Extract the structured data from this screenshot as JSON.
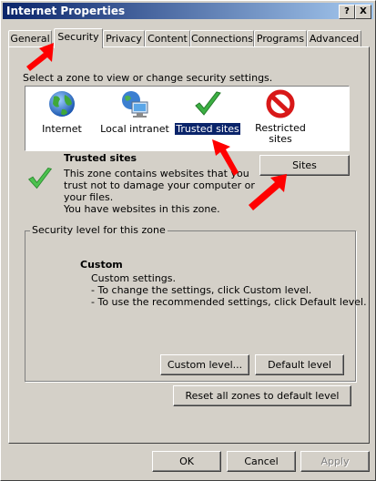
{
  "window": {
    "title": "Internet Properties",
    "help_btn": "?",
    "close_btn": "X"
  },
  "tabs": [
    {
      "label": "General"
    },
    {
      "label": "Security"
    },
    {
      "label": "Privacy"
    },
    {
      "label": "Content"
    },
    {
      "label": "Connections"
    },
    {
      "label": "Programs"
    },
    {
      "label": "Advanced"
    }
  ],
  "security": {
    "instruction": "Select a zone to view or change security settings.",
    "zones": [
      {
        "label": "Internet",
        "icon": "globe-icon"
      },
      {
        "label": "Local intranet",
        "icon": "local-intranet-icon"
      },
      {
        "label": "Trusted sites",
        "icon": "checkmark-icon"
      },
      {
        "label": "Restricted sites",
        "icon": "restricted-icon"
      }
    ],
    "selected_zone": {
      "title": "Trusted sites",
      "desc1": "This zone contains websites that you",
      "desc2": "trust not to damage your computer or",
      "desc3": "your files.",
      "desc4": "You have websites in this zone."
    },
    "sites_button": "Sites",
    "level_group_title": "Security level for this zone",
    "custom_title": "Custom",
    "custom_line1": "Custom settings.",
    "custom_line2": "- To change the settings, click Custom level.",
    "custom_line3": "- To use the recommended settings, click Default level.",
    "custom_level_button": "Custom level...",
    "default_level_button": "Default level",
    "reset_button": "Reset all zones to default level"
  },
  "footer": {
    "ok": "OK",
    "cancel": "Cancel",
    "apply": "Apply"
  },
  "colors": {
    "accent": "#0a246a",
    "annotation_arrow": "#ff0000",
    "check": "#3cb043"
  }
}
